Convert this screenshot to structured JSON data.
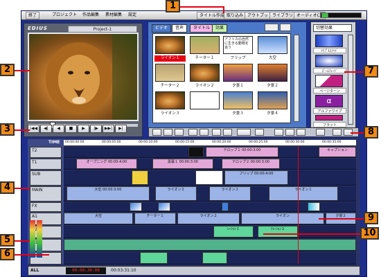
{
  "menu": {
    "quit": "終了",
    "project": "プロジェクト",
    "work_edit": "作品編集",
    "material_edit": "素材編集",
    "settings": "設定",
    "title_create": "タイトル作成",
    "import": "取り込み",
    "output": "アウトプット",
    "library": "ライブラリ",
    "audio": "オーディオCD"
  },
  "preview": {
    "project_name": "Project-1",
    "logo": "EDIUS",
    "transport": [
      "|◀◀",
      "◀|",
      "◀",
      "■",
      "▶",
      "|▶",
      "▶▶|",
      "▶|"
    ]
  },
  "library": {
    "tabs": [
      "ビデオ",
      "音声",
      "タイトル",
      "効果"
    ],
    "items": [
      {
        "label": "ライオン１",
        "selected": true
      },
      {
        "label": "チーター１",
        "selected": false
      },
      {
        "label": "フリップ",
        "selected": false
      },
      {
        "label": "大空",
        "selected": false
      },
      {
        "label": "チーター２",
        "selected": false
      },
      {
        "label": "ライオン２",
        "selected": false
      },
      {
        "label": "夕景１",
        "selected": false
      },
      {
        "label": "夕景２",
        "selected": false
      },
      {
        "label": "ライオン３",
        "selected": false
      },
      {
        "label": "",
        "selected": false
      },
      {
        "label": "夕景３",
        "selected": false
      },
      {
        "label": "夕景４",
        "selected": false
      }
    ],
    "flip_text": "アフリカの自然に生きる動物を追う"
  },
  "effects": {
    "category": "切替効果",
    "items": [
      {
        "label": "ﾄﾘﾌﾟﾙｽﾗｲﾄﾞ"
      },
      {
        "label": "ｽﾞｰﾑﾌｪｰﾄﾞ"
      },
      {
        "label": "ページターン"
      },
      {
        "label": "アルファワイプ"
      },
      {
        "label": "フラット"
      }
    ]
  },
  "timeline": {
    "time_label": "TIME",
    "ruler": [
      "00:00:00:00",
      "00:00:05:00",
      "00:00:10:00",
      "00:00:15:00",
      "00:00:20:00",
      "00:00:25:00",
      "00:00:30:00",
      "00:00:35:00"
    ],
    "tracks": {
      "t2": [
        {
          "label": "テロップ１ 00:00:3:00"
        },
        {
          "label": "キャプション"
        }
      ],
      "t1": [
        {
          "label": "オープニング 00:00:4:00"
        },
        {
          "label": "黒幕１ 00:00:3:00"
        },
        {
          "label": "テロップ２ 00:00:3:00"
        }
      ],
      "sub": [
        {
          "label": "フリップ 00:00:4:00"
        }
      ],
      "main": [
        {
          "label": "大空 00:00:3:00"
        },
        {
          "label": "ライオン２"
        },
        {
          "label": "ライオン３"
        },
        {
          "label": "ライオン１"
        }
      ],
      "a1": [
        {
          "label": "大空"
        },
        {
          "label": "チーター１"
        },
        {
          "label": "ライオン２"
        },
        {
          "label": "ライオン"
        },
        {
          "label": "夕景２"
        }
      ],
      "a2": [
        {
          "label": "ﾚｰｼｮﾝ１"
        },
        {
          "label": "ﾅﾚｰｼｮﾝ２"
        }
      ]
    },
    "track_heads": [
      "T2",
      "T1",
      "SUB",
      "MAIN",
      "FX",
      "A1",
      "A2",
      "A3",
      "A4",
      "BGM"
    ]
  },
  "status": {
    "zoom": "ALL",
    "timecode": "00:00:30:00",
    "duration": "00:03:31:10"
  },
  "callouts": [
    "1",
    "2",
    "3",
    "4",
    "5",
    "6",
    "7",
    "8",
    "9",
    "10"
  ],
  "colors": {
    "app_bg": "#1d2e8e",
    "library_bg": "#4b78c8",
    "selected": "#e60012",
    "callout": "#f08a18"
  }
}
